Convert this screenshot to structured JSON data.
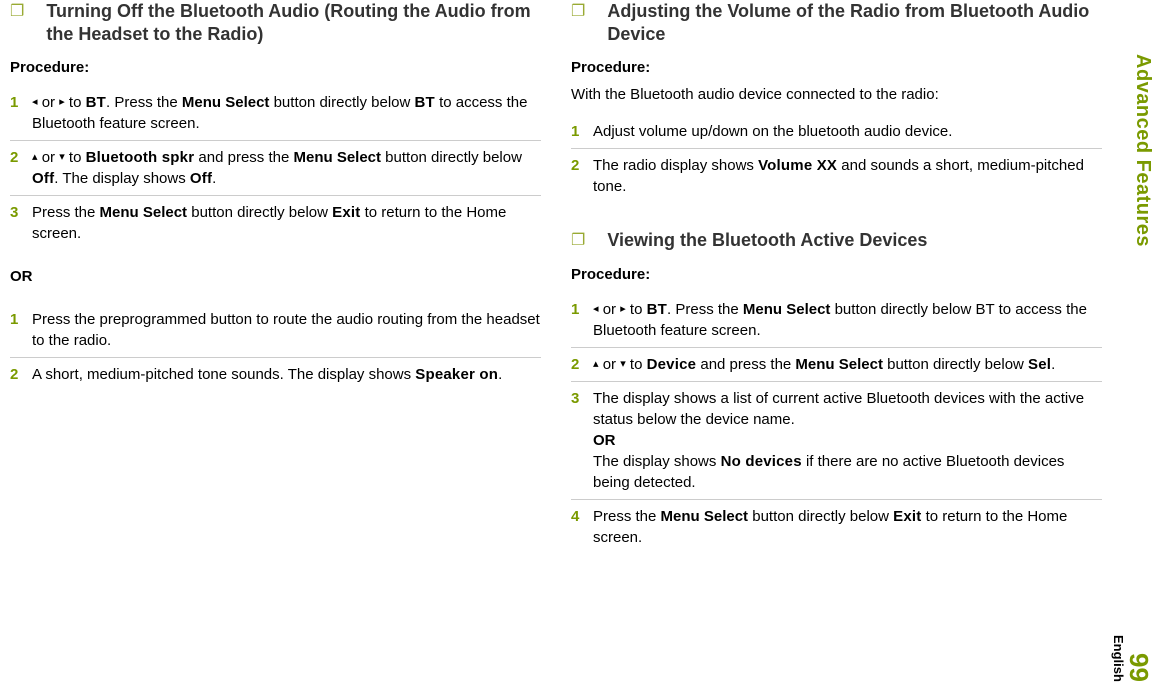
{
  "sideTab": "Advanced Features",
  "pageNumber": "99",
  "language": "English",
  "left": {
    "section1": {
      "title": "Turning Off the Bluetooth Audio (Routing the Audio from the Headset to the Radio)",
      "procedureLabel": "Procedure:",
      "steps": [
        {
          "n": "1",
          "pre": "",
          "tri1": "◂",
          "mid1": " or ",
          "tri2": "▸",
          "mid2": " to ",
          "r1": "BT",
          "t1": ". Press the ",
          "b1": "Menu Select",
          "t2": " button directly below ",
          "r2": "BT",
          "t3": " to access the Bluetooth feature screen."
        },
        {
          "n": "2",
          "tri1": "▴",
          "mid1": " or ",
          "tri2": "▾",
          "mid2": " to ",
          "r1": "Bluetooth spkr",
          "t1": " and press the ",
          "b1": "Menu Select",
          "t2": " button directly below ",
          "r2": "Off",
          "t3": ". The display shows ",
          "r3": "Off",
          "t4": "."
        },
        {
          "n": "3",
          "t0": "Press the ",
          "b1": "Menu Select",
          "t1": " button directly below ",
          "r1": "Exit",
          "t2": " to return to the Home screen."
        }
      ],
      "orLabel": "OR",
      "steps2": [
        {
          "n": "1",
          "text": "Press the preprogrammed button to route the audio routing from the headset to the radio."
        },
        {
          "n": "2",
          "t0": "A short, medium-pitched tone sounds. The display shows ",
          "r1": "Speaker on",
          "t1": "."
        }
      ]
    }
  },
  "right": {
    "section1": {
      "title": "Adjusting the Volume of the Radio from Bluetooth Audio Device",
      "procedureLabel": "Procedure:",
      "intro": "With the Bluetooth audio device connected to the radio:",
      "steps": [
        {
          "n": "1",
          "text": "Adjust volume up/down on the bluetooth audio device."
        },
        {
          "n": "2",
          "t0": "The radio display shows ",
          "r1": "Volume XX",
          "t1": " and sounds a short, medium-pitched tone."
        }
      ]
    },
    "section2": {
      "title": "Viewing the Bluetooth Active Devices",
      "procedureLabel": "Procedure:",
      "steps": [
        {
          "n": "1",
          "tri1": "◂",
          "mid1": " or ",
          "tri2": "▸",
          "mid2": " to ",
          "r1": "BT",
          "t1": ". Press the ",
          "b1": "Menu Select",
          "t2": " button directly below BT to access the Bluetooth feature screen."
        },
        {
          "n": "2",
          "tri1": "▴",
          "mid1": " or ",
          "tri2": "▾",
          "mid2": " to ",
          "r1": "Device",
          "t1": " and press the ",
          "b1": "Menu Select",
          "t2": " button directly below ",
          "r2": "Sel",
          "t3": "."
        },
        {
          "n": "3",
          "t0": "The display shows a list of current active Bluetooth devices with the active status below the device name.",
          "br": "OR",
          "t1": "The display shows ",
          "r1": "No devices",
          "t2": " if there are no active Bluetooth devices being detected."
        },
        {
          "n": "4",
          "t0": "Press the ",
          "b1": "Menu Select",
          "t1": " button directly below ",
          "r1": "Exit",
          "t2": " to return to the Home screen."
        }
      ]
    }
  }
}
